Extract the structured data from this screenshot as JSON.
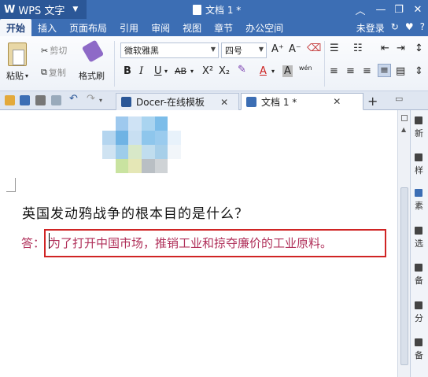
{
  "titlebar": {
    "app_logo": "W",
    "app_name": "WPS 文字",
    "doc_title": "文档 1 *",
    "buttons": [
      "minimize",
      "restore",
      "close"
    ]
  },
  "menu": {
    "items": [
      "开始",
      "插入",
      "页面布局",
      "引用",
      "审阅",
      "视图",
      "章节",
      "办公空间"
    ],
    "login": "未登录"
  },
  "ribbon": {
    "paste": "粘贴",
    "cut": "剪切",
    "copy": "复制",
    "format_painter": "格式刷",
    "font_family": "微软雅黑",
    "font_size": "四号",
    "bold": "B",
    "italic": "I",
    "underline": "U",
    "strikethrough": "AB",
    "superscript": "X²",
    "subscript": "X₂",
    "font_color": "A",
    "char_shading": "A",
    "phonetic": "wén",
    "grow_font": "A⁺",
    "shrink_font": "A⁻"
  },
  "tabs": [
    {
      "label": "Docer-在线模板",
      "active": false
    },
    {
      "label": "文档 1 *",
      "active": true
    }
  ],
  "document": {
    "question": "英国发动鸦战争的根本目的是什么？",
    "answer_label": "答：",
    "answer": "为了打开中国市场，推销工业和掠夺廉价的工业原料。"
  },
  "rightpane": {
    "items": [
      "新",
      "样",
      "素",
      "选",
      "备",
      "分",
      "备"
    ]
  },
  "colors": {
    "titlebar": "#3c6eb4",
    "answer_text": "#b0305a",
    "highlight_box": "#d02424"
  }
}
